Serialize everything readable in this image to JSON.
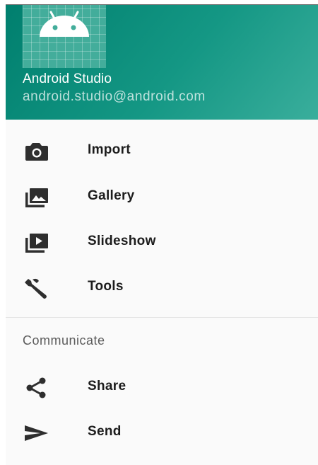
{
  "header": {
    "name": "Android Studio",
    "email": "android.studio@android.com",
    "icon": "android-icon",
    "gradient_colors": [
      "#007f6e",
      "#3aae9c"
    ]
  },
  "menu": {
    "items": [
      {
        "label": "Import",
        "icon": "camera-icon"
      },
      {
        "label": "Gallery",
        "icon": "gallery-icon"
      },
      {
        "label": "Slideshow",
        "icon": "slideshow-icon"
      },
      {
        "label": "Tools",
        "icon": "wrench-icon"
      }
    ]
  },
  "communicate": {
    "title": "Communicate",
    "items": [
      {
        "label": "Share",
        "icon": "share-icon"
      },
      {
        "label": "Send",
        "icon": "send-icon"
      }
    ]
  },
  "colors": {
    "icon": "#2e2e2e",
    "text": "#1c1c1c",
    "section_title": "#5b5b5b"
  }
}
